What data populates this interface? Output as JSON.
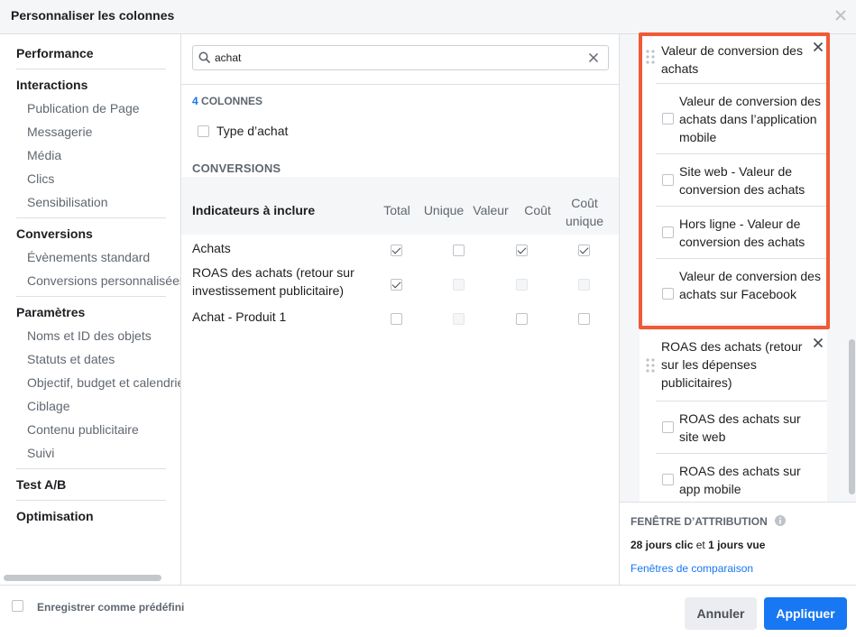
{
  "dialog": {
    "title": "Personnaliser les colonnes"
  },
  "nav": {
    "sections": [
      {
        "label": "Performance",
        "items": []
      },
      {
        "label": "Interactions",
        "items": [
          "Publication de Page",
          "Messagerie",
          "Média",
          "Clics",
          "Sensibilisation"
        ]
      },
      {
        "label": "Conversions",
        "items": [
          "Évènements standard",
          "Conversions personnalisées"
        ]
      },
      {
        "label": "Paramètres",
        "items": [
          "Noms et ID des objets",
          "Statuts et dates",
          "Objectif, budget et calendrier",
          "Ciblage",
          "Contenu publicitaire",
          "Suivi"
        ]
      },
      {
        "label": "Test A/B",
        "items": []
      },
      {
        "label": "Optimisation",
        "items": []
      }
    ]
  },
  "search": {
    "value": "achat"
  },
  "results": {
    "count_num": "4",
    "count_label": " COLONNES",
    "type_label": "Type d’achat",
    "section_title": "CONVERSIONS",
    "table": {
      "label": "Indicateurs à inclure",
      "headers": [
        "Total",
        "Unique",
        "Valeur",
        "Coût",
        "Coût unique"
      ],
      "rows": [
        {
          "name": "Achats",
          "checks": [
            "on",
            "off",
            "on",
            "on",
            "off"
          ]
        },
        {
          "name": "ROAS des achats (retour sur investissement publicitaire)",
          "checks": [
            "on",
            "dim",
            "dim",
            "dim",
            "dim"
          ]
        },
        {
          "name": "Achat - Produit 1",
          "checks": [
            "off",
            "dim",
            "off",
            "off",
            "dim"
          ]
        }
      ]
    }
  },
  "selected": [
    {
      "title": "Valeur de conversion des achats",
      "subs": [
        "Valeur de conversion des achats dans l’application mobile",
        "Site web - Valeur de conversion des achats",
        "Hors ligne - Valeur de conversion des achats",
        "Valeur de conversion des achats sur Facebook"
      ]
    },
    {
      "title": "ROAS des achats (retour sur les dépenses publicitaires)",
      "subs": [
        "ROAS des achats sur site web",
        "ROAS des achats sur app mobile"
      ]
    }
  ],
  "attribution": {
    "title": "FENÊTRE D’ATTRIBUTION",
    "click": "28 jours clic",
    "and": " et ",
    "view": "1 jours vue",
    "link": "Fenêtres de comparaison"
  },
  "footer": {
    "save_preset": "Enregistrer comme prédéfini",
    "cancel": "Annuler",
    "apply": "Appliquer"
  },
  "colors": {
    "accent": "#1877f2",
    "highlight": "#f05a36"
  }
}
